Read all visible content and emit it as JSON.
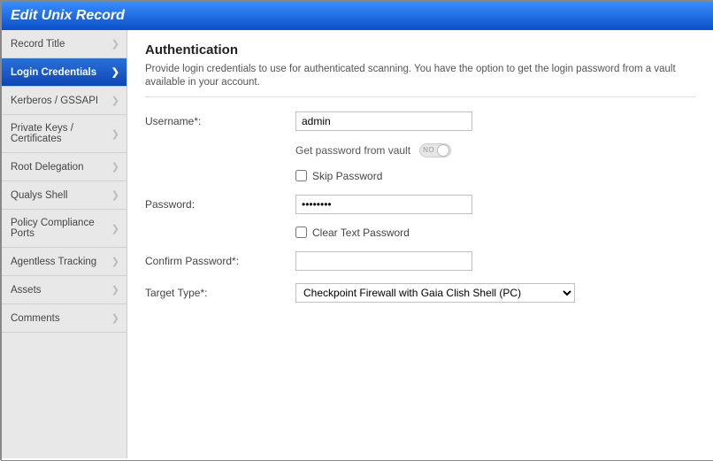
{
  "window": {
    "title": "Edit Unix Record"
  },
  "sidebar": {
    "items": [
      {
        "label": "Record Title"
      },
      {
        "label": "Login Credentials",
        "active": true
      },
      {
        "label": "Kerberos / GSSAPI"
      },
      {
        "label": "Private Keys / Certificates"
      },
      {
        "label": "Root Delegation"
      },
      {
        "label": "Qualys Shell"
      },
      {
        "label": "Policy Compliance Ports"
      },
      {
        "label": "Agentless Tracking"
      },
      {
        "label": "Assets"
      },
      {
        "label": "Comments"
      }
    ]
  },
  "section": {
    "title": "Authentication",
    "description": "Provide login credentials to use for authenticated scanning. You have the option to get the login password from a vault available in your account."
  },
  "form": {
    "username_label": "Username*:",
    "username_value": "admin",
    "vault_label": "Get password from vault",
    "vault_state": "NO",
    "skip_password_label": "Skip Password",
    "password_label": "Password:",
    "password_value": "••••••••",
    "clear_text_label": "Clear Text Password",
    "confirm_label": "Confirm Password*:",
    "confirm_value": "",
    "target_label": "Target Type*:",
    "target_value": "Checkpoint Firewall with Gaia Clish Shell (PC)"
  }
}
